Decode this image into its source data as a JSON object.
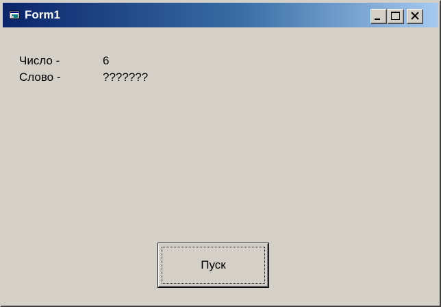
{
  "window": {
    "title": "Form1",
    "icon": "vb-form-icon"
  },
  "titlebar_buttons": {
    "minimize_icon": "minimize-icon",
    "maximize_icon": "maximize-icon",
    "close_icon": "close-icon"
  },
  "form": {
    "number_caption": "Число -",
    "number_value": "6",
    "word_caption": "Слово -",
    "word_value": "???????"
  },
  "run_button": {
    "label": "Пуск"
  },
  "colors": {
    "titlebar_start": "#0a246a",
    "titlebar_end": "#a6caf0",
    "face": "#d4d0c8"
  }
}
